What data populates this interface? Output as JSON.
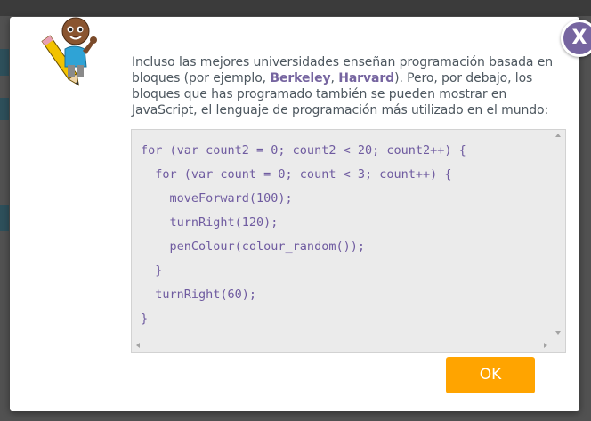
{
  "dialog": {
    "close_label": "X",
    "intro_before": "Incluso las mejores universidades enseñan programación basada en bloques (por ejemplo, ",
    "link_berkeley": "Berkeley",
    "intro_sep": ", ",
    "link_harvard": "Harvard",
    "intro_after": "). Pero, por debajo, los bloques que has programado también se pueden mostrar en JavaScript, el lenguaje de programación más utilizado en el mundo:",
    "ok_label": "OK"
  },
  "code": {
    "lines": [
      "for (var count2 = 0; count2 < 20; count2++) {",
      "  for (var count = 0; count < 3; count++) {",
      "    moveForward(100);",
      "    turnRight(120);",
      "    penColour(colour_random());",
      "  }",
      "  turnRight(60);",
      "}"
    ]
  },
  "colors": {
    "accent_purple": "#7665a0",
    "ok_orange": "#ffa400",
    "code_text": "#6f5ba0",
    "code_bg": "#ebebeb",
    "body_text": "#4d575f"
  },
  "icons": {
    "mascot": "pencil-character-icon",
    "close": "close-icon"
  }
}
